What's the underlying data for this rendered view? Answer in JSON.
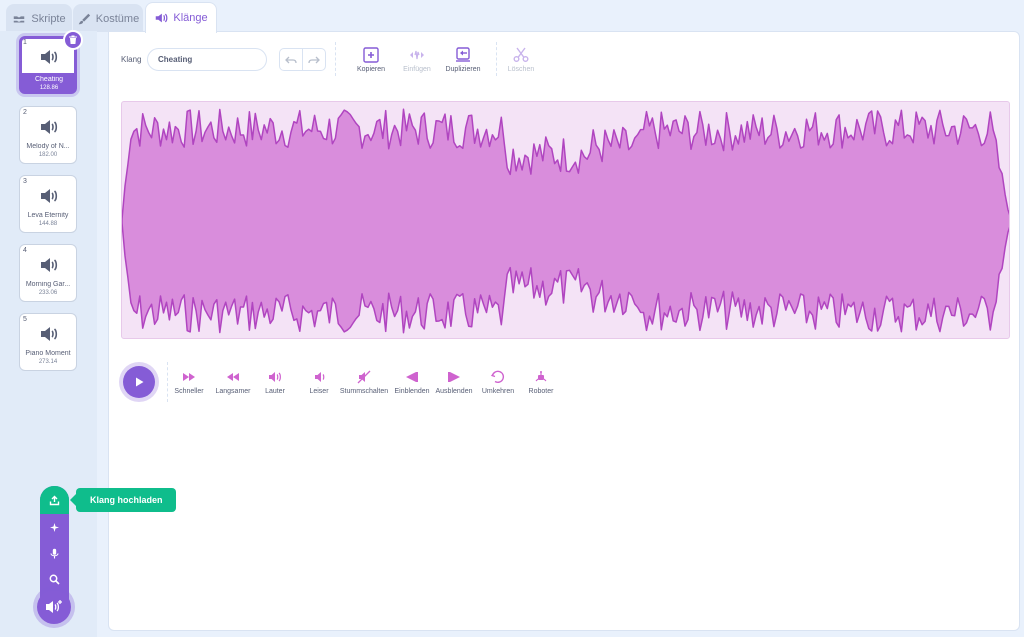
{
  "tabs": [
    {
      "label": "Skripte",
      "icon": "code-icon",
      "active": false
    },
    {
      "label": "Kostüme",
      "icon": "brush-icon",
      "active": false
    },
    {
      "label": "Klänge",
      "icon": "speaker-icon",
      "active": true
    }
  ],
  "sounds": [
    {
      "num": "1",
      "name": "Cheating",
      "duration": "128.86",
      "selected": true
    },
    {
      "num": "2",
      "name": "Melody of N...",
      "duration": "182.00",
      "selected": false
    },
    {
      "num": "3",
      "name": "Leva Eternity",
      "duration": "144.88",
      "selected": false
    },
    {
      "num": "4",
      "name": "Morning Gar...",
      "duration": "233.06",
      "selected": false
    },
    {
      "num": "5",
      "name": "Piano Moment",
      "duration": "273.14",
      "selected": false
    }
  ],
  "editor": {
    "field_label": "Klang",
    "sound_name": "Cheating",
    "tools": {
      "copy": "Kopieren",
      "paste": "Einfügen",
      "duplicate": "Duplizieren",
      "delete": "Löschen"
    }
  },
  "effects": {
    "faster": "Schneller",
    "slower": "Langsamer",
    "louder": "Lauter",
    "softer": "Leiser",
    "mute": "Stummschalten",
    "fade_in": "Einblenden",
    "fade_out": "Ausblenden",
    "reverse": "Umkehren",
    "robot": "Roboter"
  },
  "add_menu": {
    "tooltip": "Klang hochladen"
  },
  "colors": {
    "accent": "#855cd6",
    "wave_fill": "#d98ddc",
    "wave_stroke": "#b045c0",
    "upload": "#0fbd8c"
  }
}
